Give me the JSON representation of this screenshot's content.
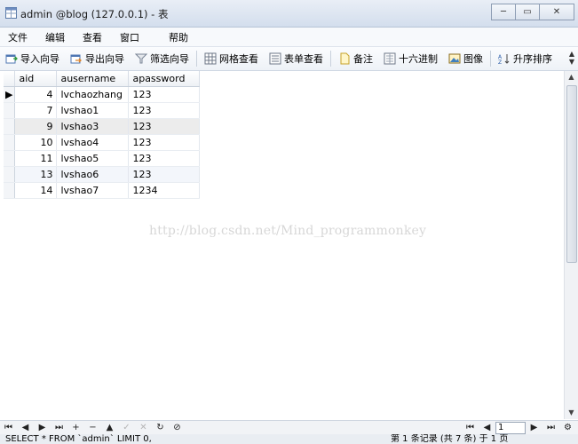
{
  "window": {
    "title": "admin @blog (127.0.0.1) - 表",
    "minimize": "─",
    "restore": "▭",
    "close": "✕"
  },
  "menu": [
    "文件",
    "编辑",
    "查看",
    "窗口",
    "帮助"
  ],
  "toolbar": {
    "import_wizard": "导入向导",
    "export_wizard": "导出向导",
    "filter_wizard": "筛选向导",
    "grid_view": "网格查看",
    "form_view": "表单查看",
    "memo": "备注",
    "hex": "十六进制",
    "image": "图像",
    "sort_asc": "升序排序",
    "more": "▲▼"
  },
  "table": {
    "columns": [
      "aid",
      "ausername",
      "apassword"
    ],
    "rows": [
      {
        "aid": "4",
        "ausername": "lvchaozhang",
        "apassword": "123"
      },
      {
        "aid": "7",
        "ausername": "lvshao1",
        "apassword": "123"
      },
      {
        "aid": "9",
        "ausername": "lvshao3",
        "apassword": "123"
      },
      {
        "aid": "10",
        "ausername": "lvshao4",
        "apassword": "123"
      },
      {
        "aid": "11",
        "ausername": "lvshao5",
        "apassword": "123"
      },
      {
        "aid": "13",
        "ausername": "lvshao6",
        "apassword": "123"
      },
      {
        "aid": "14",
        "ausername": "lvshao7",
        "apassword": "1234"
      }
    ]
  },
  "watermark": "http://blog.csdn.net/Mind_programmonkey",
  "navbar": {
    "first": "⏮",
    "prev": "◀",
    "next": "▶",
    "last": "⏭",
    "add": "+",
    "delete": "−",
    "up": "▲",
    "apply": "✓",
    "cancel": "✕",
    "refresh": "↻",
    "stop": "⊘",
    "page": "1"
  },
  "status": {
    "sql": "SELECT * FROM `admin` LIMIT 0,",
    "records": "第 1 条记录 (共 7 条) 于 1 页"
  },
  "colors": {
    "selected_row": "#ececec",
    "alt_row": "#f3f6fb",
    "titlebar": "#d3deed"
  }
}
